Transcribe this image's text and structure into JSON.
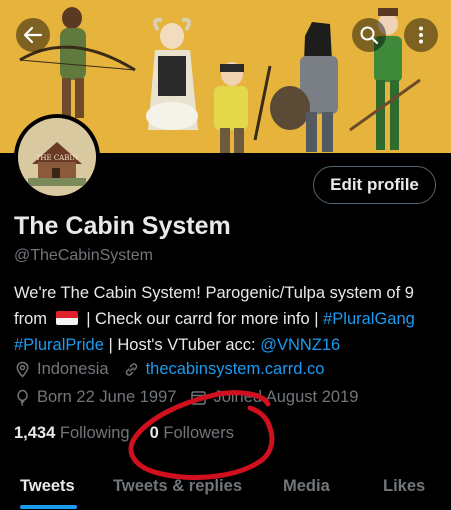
{
  "profile": {
    "display_name": "The Cabin System",
    "handle": "@TheCabinSystem",
    "avatar_text": "THE CABIN",
    "edit_label": "Edit profile"
  },
  "bio": {
    "line1": "We're The Cabin System! Parogenic/Tulpa system of 9",
    "from": "from",
    "mid": "| Check our carrd for more info |",
    "tag1": "#PluralGang",
    "tag2": "#PluralPride",
    "host_text": "| Host's VTuber acc:",
    "mention": "@VNNZ16"
  },
  "meta": {
    "location": "Indonesia",
    "website": "thecabinsystem.carrd.co",
    "birthday": "Born 22 June 1997",
    "joined": "Joined August 2019"
  },
  "stats": {
    "following_count": "1,434",
    "following_label": "Following",
    "followers_count": "0",
    "followers_label": "Followers"
  },
  "tabs": [
    "Tweets",
    "Tweets & replies",
    "Media",
    "Likes"
  ],
  "icons": {
    "back": "back-arrow-icon",
    "search": "search-icon",
    "more": "more-vertical-icon",
    "location": "location-pin-icon",
    "link": "link-icon",
    "birthday": "balloon-icon",
    "calendar": "calendar-icon"
  },
  "colors": {
    "accent": "#1d9bf0",
    "annotation": "#d0101e",
    "banner": "#e6b33c"
  }
}
